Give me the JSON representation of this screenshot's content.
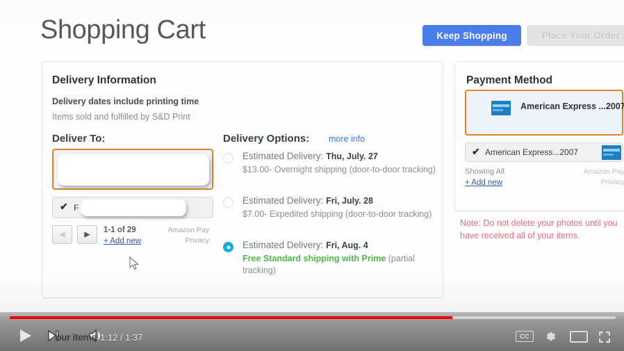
{
  "header": {
    "title": "Shopping Cart",
    "keep_shopping_label": "Keep Shopping",
    "place_order_label": "Place Your Order"
  },
  "delivery": {
    "panel_title": "Delivery Information",
    "note_bold": "Delivery dates include printing time",
    "note_sub": "Items sold and fulfilled by S&D Print",
    "deliver_to_label": "Deliver To:",
    "address": {
      "alternate_check": "✔",
      "alternate_text": "F",
      "pager_count": "1-1 of 29",
      "add_new": "+ Add new",
      "amazon_pay": "Amazon Pay",
      "privacy": "Privacy",
      "prev_glyph": "◀",
      "next_glyph": "▶"
    },
    "options_label": "Delivery Options:",
    "more_info": "more info",
    "options": [
      {
        "selected": false,
        "prefix": "Estimated Delivery:",
        "date": "Thu, July. 27",
        "detail": "$13.00- Overnight shipping (door-to-door tracking)",
        "free_text": ""
      },
      {
        "selected": false,
        "prefix": "Estimated Delivery:",
        "date": "Fri, July. 28",
        "detail": "$7.00- Expedited shipping (door-to-door tracking)",
        "free_text": ""
      },
      {
        "selected": true,
        "prefix": "Estimated Delivery:",
        "date": "Fri, Aug. 4",
        "detail": " (partial tracking)",
        "free_text": "Free Standard shipping with Prime"
      }
    ]
  },
  "payment": {
    "panel_title": "Payment Method",
    "selected_label": "American Express ...2007",
    "alternate_check": "✔",
    "alternate_label": "American Express...2007",
    "showing_all": "Showing All",
    "add_new": "+ Add new",
    "amazon_pay": "Amazon Pay",
    "privacy": "Privacy"
  },
  "note": {
    "text": "Note: Do not delete your photos until you have received all of your items."
  },
  "player": {
    "time": "1:12 / 1:37",
    "current_time": "1:12",
    "duration": "1:37",
    "progress_percent": 73,
    "ghost_text": "our items",
    "cc_label": "CC"
  },
  "colors": {
    "accent_blue": "#4a7dea",
    "highlight_orange": "#e08027",
    "free_shipping_green": "#52b749",
    "note_red": "#ef6c7e",
    "radio_selected": "#0bb0e0",
    "progress_red": "#f00000"
  }
}
